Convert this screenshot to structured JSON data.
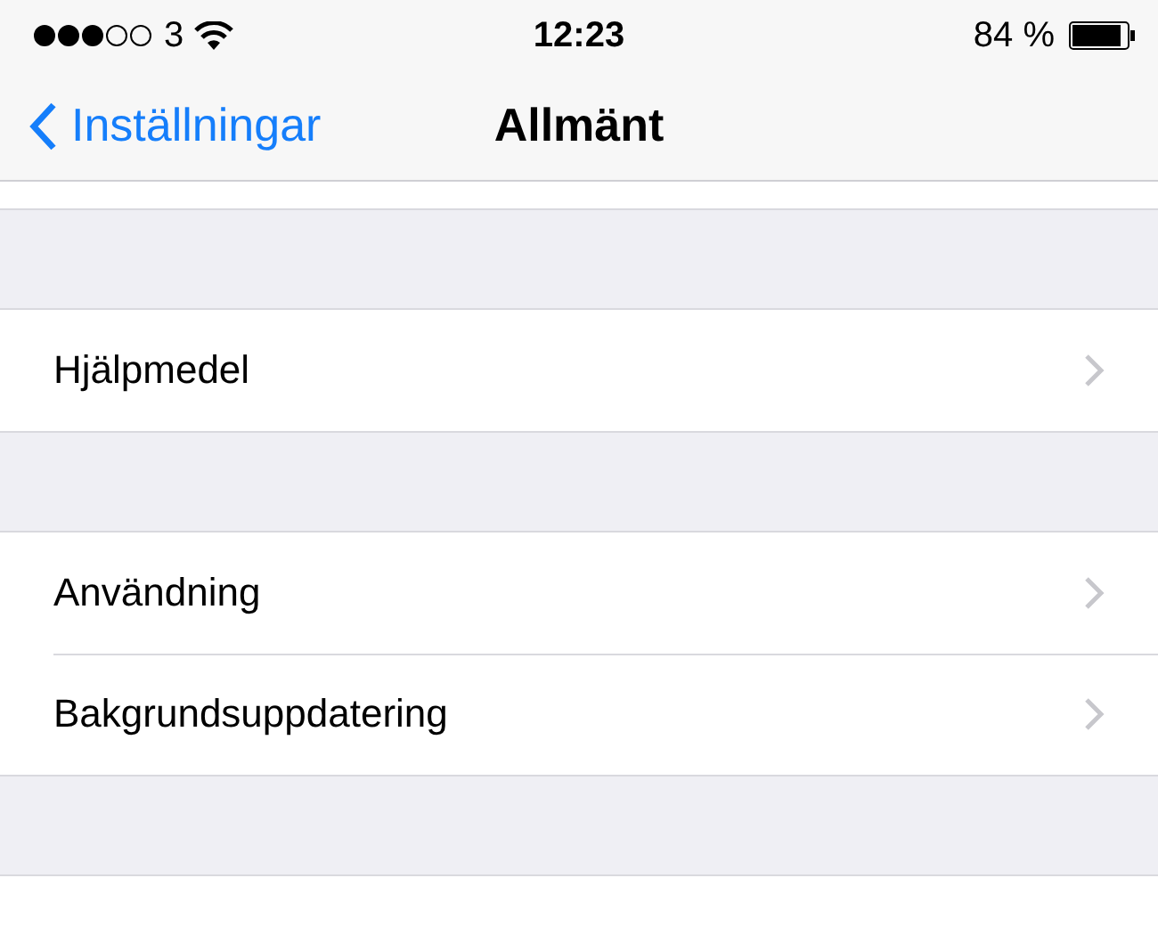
{
  "status_bar": {
    "carrier": "3",
    "time": "12:23",
    "battery": "84 %"
  },
  "nav_bar": {
    "back": "Inställningar",
    "title": "Allmänt"
  },
  "groups": [
    {
      "rows": [
        {
          "label": "Hjälpmedel"
        }
      ]
    },
    {
      "rows": [
        {
          "label": "Användning"
        },
        {
          "label": "Bakgrundsuppdatering"
        }
      ]
    }
  ]
}
